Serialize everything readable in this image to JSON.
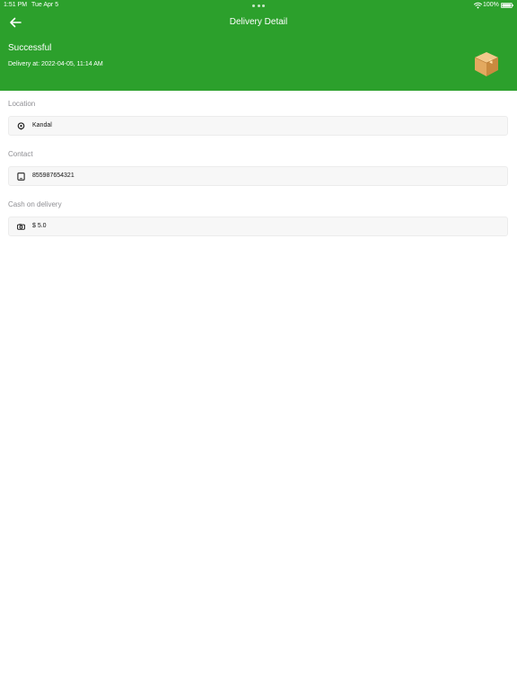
{
  "status_bar": {
    "time": "1:51 PM",
    "date": "Tue Apr 5",
    "battery": "100%"
  },
  "nav": {
    "title": "Delivery Detail",
    "back_icon": "arrow-left-icon"
  },
  "summary": {
    "status": "Successful",
    "delivered_at": "Delivery at: 2022-04-05, 11:14 AM",
    "icon": "package-box-icon"
  },
  "details": {
    "location": {
      "label": "Location",
      "value": "Kandal",
      "icon": "location-pin-icon"
    },
    "contact": {
      "label": "Contact",
      "value": "855987654321",
      "icon": "phone-icon"
    },
    "cash": {
      "label": "Cash on delivery",
      "value": "$ 5.0",
      "icon": "cash-icon"
    }
  },
  "colors": {
    "header_bg": "#2ca02c",
    "header_text": "#ffffff",
    "label_text": "#8e8e93",
    "field_bg": "#f7f7f7"
  }
}
